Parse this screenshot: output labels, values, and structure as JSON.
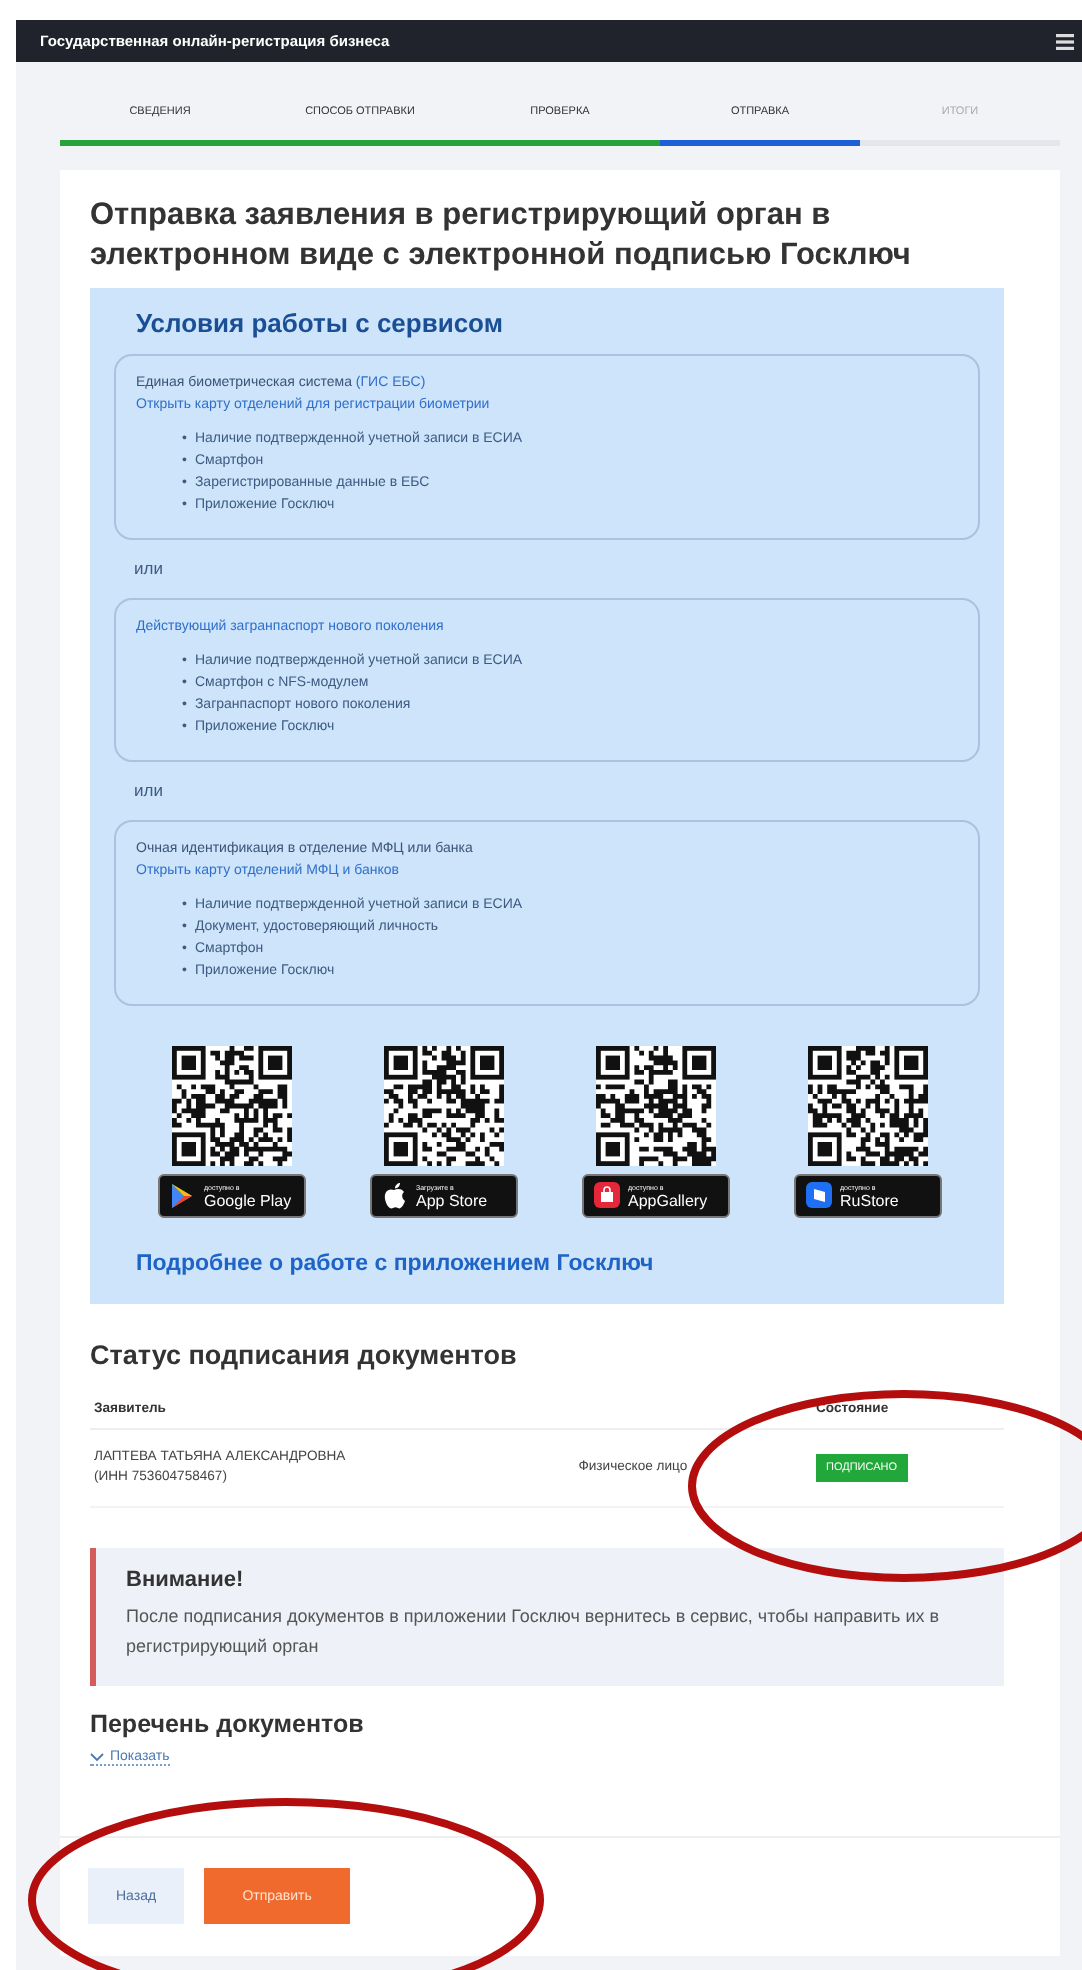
{
  "header": {
    "title": "Государственная онлайн-регистрация бизнеса"
  },
  "steps": [
    {
      "label": "СВЕДЕНИЯ",
      "completed": true,
      "selected": false
    },
    {
      "label": "СПОСОБ ОТПРАВКИ",
      "completed": true,
      "selected": false
    },
    {
      "label": "ПРОВЕРКА",
      "completed": true,
      "selected": false
    },
    {
      "label": "ОТПРАВКА",
      "completed": false,
      "selected": true
    },
    {
      "label": "ИТОГИ",
      "completed": false,
      "selected": false
    }
  ],
  "page_title": "Отправка заявления в регистрирующий орган в электронном виде с электронной подписью Госключ",
  "conditions": {
    "heading": "Условия работы с сервисом",
    "bullet": "•",
    "groups": [
      {
        "lines": [
          [
            {
              "text": "Единая биометрическая система ",
              "link": false
            },
            {
              "text": "(ГИС ЕБС)",
              "link": true
            }
          ],
          [
            {
              "text": "Открыть карту отделений для регистрации биометрии",
              "link": true
            }
          ]
        ],
        "items": [
          "Наличие подтвержденной учетной записи в ЕСИА",
          "Смартфон",
          "Зарегистрированные данные в ЕБС",
          "Приложение Госключ"
        ]
      },
      {
        "separator": "или",
        "lines": [
          [
            {
              "text": "Действующий загранпаспорт нового поколения",
              "link": true
            }
          ]
        ],
        "items": [
          "Наличие подтвержденной учетной записи в ЕСИА",
          "Смартфон с NFS-модулем",
          "Загранпаспорт нового поколения",
          "Приложение Госключ"
        ]
      },
      {
        "separator": "или",
        "lines": [
          [
            {
              "text": "Очная идентификация в отделение МФЦ или банка",
              "link": false
            }
          ],
          [
            {
              "text": "Открыть карту отделений МФЦ и банков",
              "link": true
            }
          ]
        ],
        "items": [
          "Наличие подтвержденной учетной записи в ЕСИА",
          "Документ, удостоверяющий личность",
          "Смартфон",
          "Приложение Госключ"
        ]
      }
    ]
  },
  "apps": [
    {
      "kind": "google",
      "caption": "доступно в",
      "store": "Google Play"
    },
    {
      "kind": "apple",
      "caption": "Загрузите в",
      "store": "App Store"
    },
    {
      "kind": "huawei",
      "caption": "доступно в",
      "store": "AppGallery"
    },
    {
      "kind": "rustore",
      "caption": "доступно в",
      "store": "RuStore"
    }
  ],
  "more_link": "Подробнее о работе с приложением Госключ",
  "signing": {
    "heading": "Статус подписания документов",
    "columns": {
      "applicant": "Заявитель",
      "status": "Состояние"
    },
    "rows": [
      {
        "applicant": "ЛАПТЕВА ТАТЬЯНА АЛЕКСАНДРОВНА",
        "inn": "(ИНН 753604758467)",
        "type": "Физическое лицо",
        "status": "ПОДПИСАНО"
      }
    ]
  },
  "notice": {
    "title": "Внимание!",
    "text": "После подписания документов в приложении Госключ вернитесь в сервис, чтобы направить их в регистрирующий орган"
  },
  "documents": {
    "heading": "Перечень документов",
    "toggle": "Показать",
    "expanded": false
  },
  "buttons": [
    {
      "label": "Назад",
      "kind": "secondary"
    },
    {
      "label": "Отправить",
      "kind": "primary"
    }
  ]
}
